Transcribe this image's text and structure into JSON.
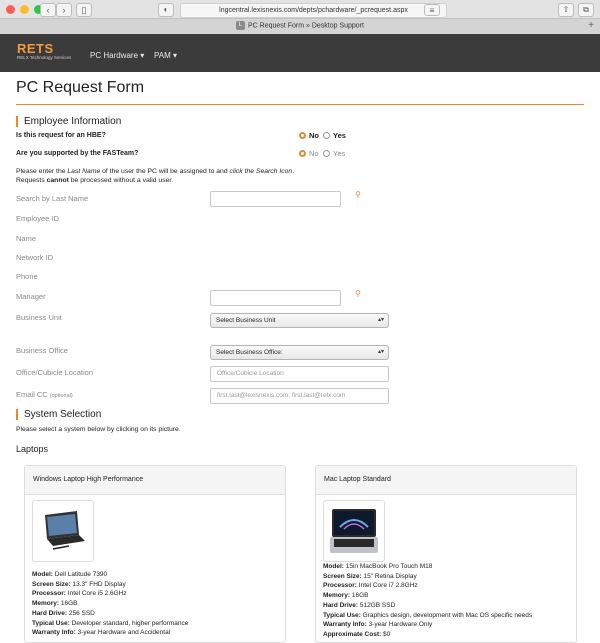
{
  "browser": {
    "url": "lngcentral.lexisnexis.com/depts/pchardware/_pcrequest.aspx",
    "tab_title": "PC Request Form » Desktop Support",
    "tab_favicon": "L"
  },
  "site": {
    "logo_title": "RETS",
    "logo_subtitle": "RELX Technology Services",
    "nav": [
      "PC Hardware ▾",
      "PAM ▾"
    ]
  },
  "page": {
    "title": "PC Request Form",
    "employee_section": "Employee Information",
    "q_hbe": "Is this request for an HBE?",
    "q_fasteam": "Are you supported by the FASTeam?",
    "opt_no": "No",
    "opt_yes": "Yes",
    "note_line1_a": "Please enter the ",
    "note_line1_b": "Last Name",
    "note_line1_c": " of the user the PC will be assigned to and ",
    "note_line1_d": "click the Search Icon",
    "note_line1_e": ".",
    "note_line2_a": "Requests ",
    "note_line2_b": "cannot",
    "note_line2_c": " be processed without a valid user.",
    "fields": {
      "search_last_name": "Search by Last Name",
      "employee_id": "Employee ID",
      "name": "Name",
      "network_id": "Network ID",
      "phone": "Phone",
      "manager": "Manager",
      "business_unit": "Business Unit",
      "business_office": "Business Office",
      "office_cubicle": "Office/Cubicle Location",
      "email_cc": "Email CC",
      "email_cc_optional": "(optional)"
    },
    "selects": {
      "business_unit": "Select Business Unit",
      "business_office": "Select Business Office:"
    },
    "placeholders": {
      "office_cubicle": "Office/Cubicle Location",
      "email_cc": "first.last@lexisnexis.com; first.last@relx.com"
    },
    "system_section": "System Selection",
    "system_note": "Please select a system below by clicking on its picture.",
    "laptops_heading": "Laptops"
  },
  "cards": [
    {
      "title": "Windows Laptop High Performance",
      "specs": [
        {
          "k": "Model:",
          "v": " Dell Latitude 7390"
        },
        {
          "k": "Screen Size:",
          "v": " 13.3\" FHD Display"
        },
        {
          "k": "Processor:",
          "v": " Intel Core i5 2.6GHz"
        },
        {
          "k": "Memory:",
          "v": " 16GB"
        },
        {
          "k": "Hard Drive:",
          "v": " 256 SSD"
        },
        {
          "k": "Typical Use:",
          "v": " Developer standard, higher performance"
        },
        {
          "k": "Warranty Info:",
          "v": " 3-year Hardware and Accidental"
        }
      ]
    },
    {
      "title": "Mac Laptop Standard",
      "specs": [
        {
          "k": "Model:",
          "v": " 15in MacBook Pro Touch M18"
        },
        {
          "k": "Screen Size:",
          "v": " 15\" Retina Display"
        },
        {
          "k": "Processor:",
          "v": " Intel Core i7 2.8GHz"
        },
        {
          "k": "Memory:",
          "v": " 16GB"
        },
        {
          "k": "Hard Drive:",
          "v": " 512GB SSD"
        },
        {
          "k": "Typical Use:",
          "v": " Graphics design, development with Mac OS specific needs"
        },
        {
          "k": "Warranty Info:",
          "v": " 3-year Hardware Only"
        },
        {
          "k": "Approximate Cost:",
          "v": " $0"
        }
      ]
    }
  ],
  "colors": {
    "accent": "#e58a33",
    "header_bg": "#3b3b3b"
  }
}
